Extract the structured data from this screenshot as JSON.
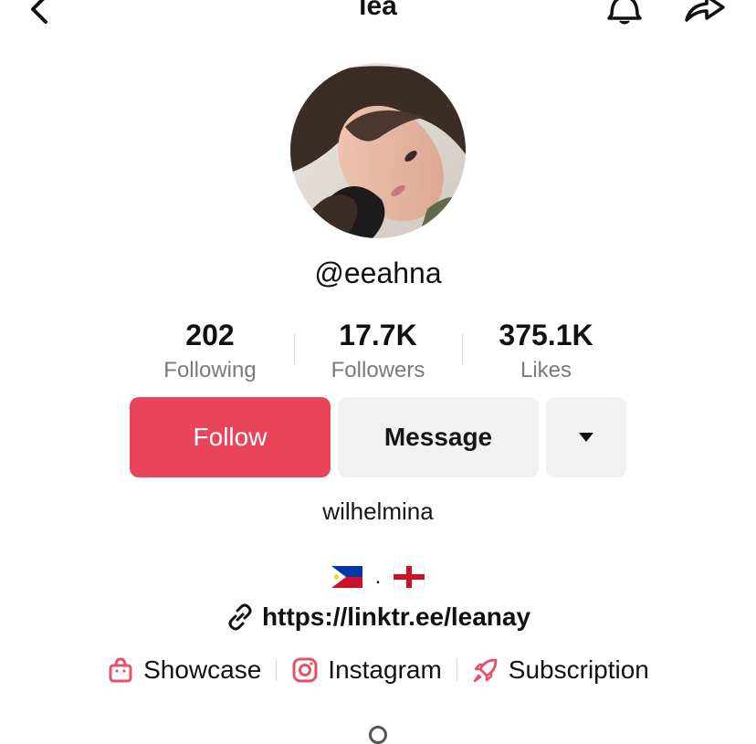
{
  "header": {
    "title": "lea",
    "back_icon": "chevron-left-icon",
    "bell_icon": "bell-icon",
    "share_icon": "share-arrow-icon"
  },
  "profile": {
    "username": "@eeahna",
    "bio": "wilhelmina",
    "flags_separator": ".",
    "link": "https://linktr.ee/leanay"
  },
  "stats": [
    {
      "value": "202",
      "label": "Following"
    },
    {
      "value": "17.7K",
      "label": "Followers"
    },
    {
      "value": "375.1K",
      "label": "Likes"
    }
  ],
  "actions": {
    "follow_label": "Follow",
    "message_label": "Message",
    "more_icon": "caret-down-icon"
  },
  "quick_links": [
    {
      "label": "Showcase",
      "icon": "shopping-bag-icon"
    },
    {
      "label": "Instagram",
      "icon": "instagram-icon"
    },
    {
      "label": "Subscription",
      "icon": "rocket-icon"
    }
  ],
  "colors": {
    "follow": "#ea445a",
    "accent_icons": "#e8506a",
    "button_gray": "#f1f1f2",
    "label_gray": "#7a7a7a"
  }
}
